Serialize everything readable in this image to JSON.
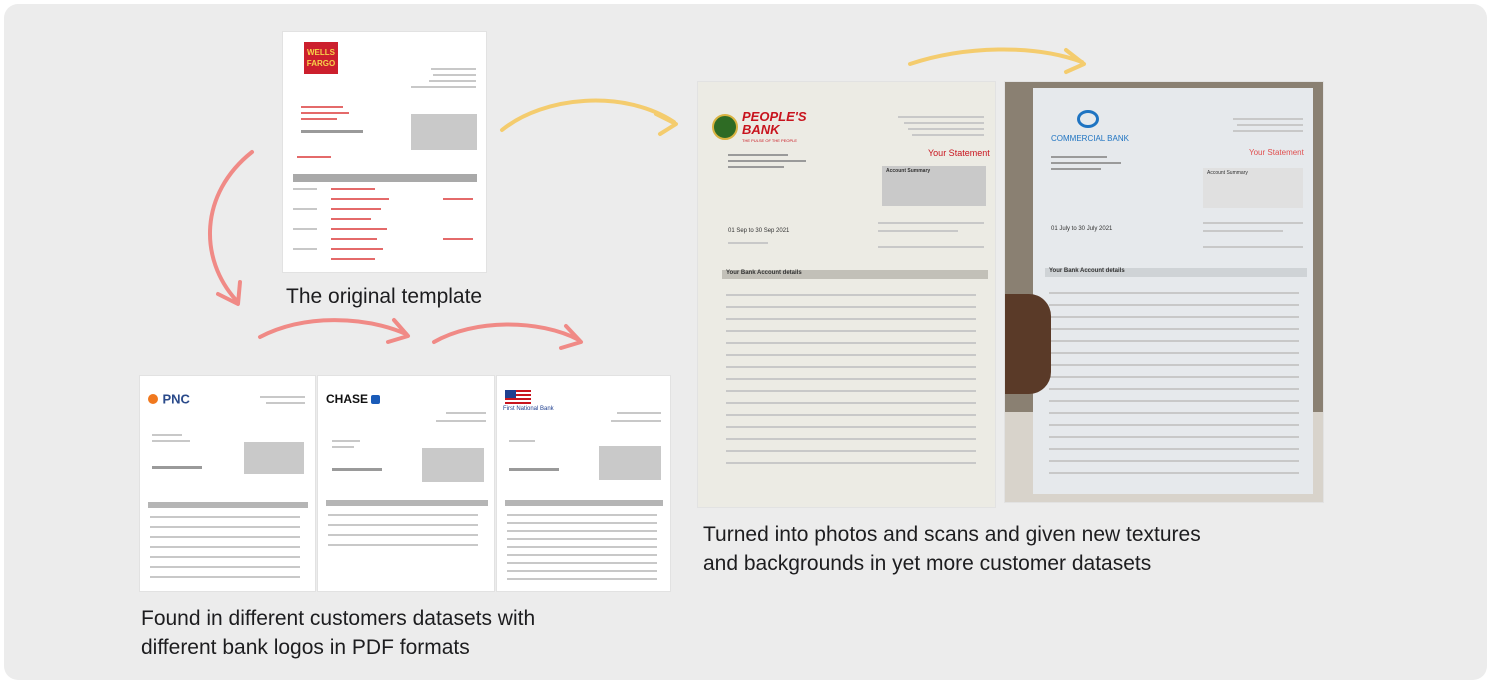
{
  "captions": {
    "original": "The original template",
    "found": "Found in different customers datasets with\ndifferent bank logos in PDF formats",
    "turned": "Turned into photos and scans and given new textures\nand backgrounds in yet more customer datasets"
  },
  "banks": {
    "wells_fargo": [
      "WELLS",
      "FARGO"
    ],
    "pnc": "PNC",
    "chase": "CHASE",
    "first_national": "First National Bank",
    "peoples": {
      "name_line1": "PEOPLE'S",
      "name_line2": "BANK",
      "tagline": "THE PULSE OF THE PEOPLE",
      "statement_title": "Your Statement",
      "period": "01 Sep to 30 Sep 2021",
      "section": "Your Bank Account details",
      "summary_title": "Account Summary"
    },
    "commercial": {
      "name": "COMMERCIAL BANK",
      "statement_title": "Your Statement",
      "period": "01 July to 30 July 2021",
      "section": "Your Bank Account details",
      "summary_title": "Account Summary"
    }
  },
  "colors": {
    "panel": "#ececec",
    "arrow_red": "#f08a86",
    "arrow_yellow": "#f4cc6e",
    "wells_red": "#cc1f2d",
    "pnc_orange": "#f0781e",
    "pnc_blue": "#2a4a8a",
    "chase_blue": "#1a5bb8",
    "peoples_red": "#c8141e",
    "commercial_blue": "#1f74c2"
  }
}
